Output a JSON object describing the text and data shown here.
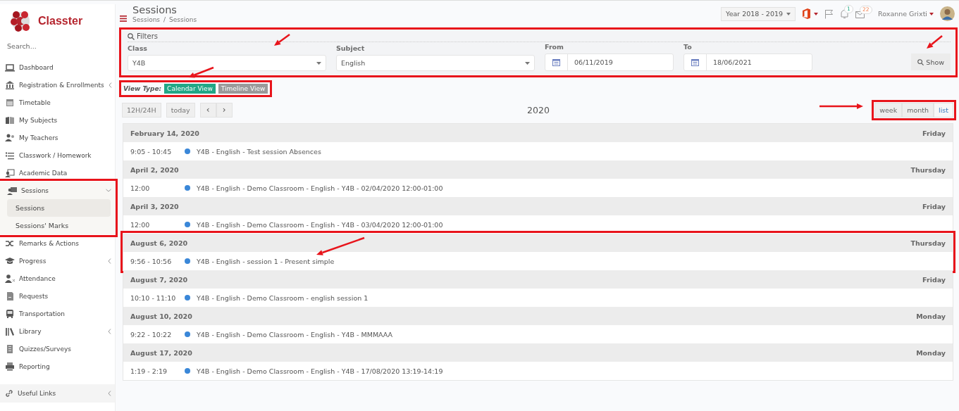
{
  "brand": {
    "name": "Classter"
  },
  "sidebar": {
    "search_placeholder": "Search...",
    "items": [
      {
        "label": "Dashboard",
        "expandable": false
      },
      {
        "label": "Registration & Enrollments",
        "expandable": true
      },
      {
        "label": "Timetable",
        "expandable": false
      },
      {
        "label": "My Subjects",
        "expandable": false
      },
      {
        "label": "My Teachers",
        "expandable": false
      },
      {
        "label": "Classwork / Homework",
        "expandable": false
      },
      {
        "label": "Academic Data",
        "expandable": false
      },
      {
        "label": "Sessions",
        "expandable": true,
        "expanded": true,
        "highlighted": true,
        "children": [
          {
            "label": "Sessions",
            "selected": true
          },
          {
            "label": "Sessions' Marks",
            "selected": false
          }
        ]
      },
      {
        "label": "Remarks & Actions",
        "expandable": false
      },
      {
        "label": "Progress",
        "expandable": true
      },
      {
        "label": "Attendance",
        "expandable": false
      },
      {
        "label": "Requests",
        "expandable": false
      },
      {
        "label": "Transportation",
        "expandable": false
      },
      {
        "label": "Library",
        "expandable": true
      },
      {
        "label": "Quizzes/Surveys",
        "expandable": false
      },
      {
        "label": "Reporting",
        "expandable": false
      }
    ],
    "footer": {
      "label": "Useful Links",
      "expandable": true
    }
  },
  "header": {
    "title": "Sessions",
    "breadcrumb": [
      "Sessions",
      "Sessions"
    ],
    "breadcrumb_separator": "/",
    "year": "Year 2018 - 2019",
    "notifications": "1",
    "messages": "22",
    "user": "Roxanne Grixti"
  },
  "filters": {
    "title": "Filters",
    "highlighted": true,
    "pointer": true,
    "fields": [
      {
        "kind": "select",
        "label": "Class",
        "value": "Y4B"
      },
      {
        "kind": "select",
        "label": "Subject",
        "value": "English"
      },
      {
        "kind": "date",
        "label": "From",
        "value": "06/11/2019"
      },
      {
        "kind": "date",
        "label": "To",
        "value": "18/06/2021"
      }
    ],
    "show_button": {
      "label": "Show",
      "pointer": true
    }
  },
  "view_type": {
    "label": "View Type:",
    "highlighted": true,
    "pointer": true,
    "options": [
      {
        "label": "Calendar View",
        "selected": true
      },
      {
        "label": "Timeline View",
        "selected": false
      }
    ]
  },
  "calendar": {
    "buttons": [
      "12H/24H",
      "today"
    ],
    "prev": "‹",
    "next": "›",
    "title": "2020",
    "views": {
      "highlighted": true,
      "pointer": true,
      "options": [
        {
          "label": "week",
          "selected": false
        },
        {
          "label": "month",
          "selected": false
        },
        {
          "label": "list",
          "selected": true
        }
      ]
    },
    "days": [
      {
        "date": "February 14, 2020",
        "weekday": "Friday",
        "highlighted": false,
        "pointer": false,
        "events": [
          {
            "time": "9:05 - 10:45",
            "title": "Y4B - English - Test session Absences"
          }
        ]
      },
      {
        "date": "April 2, 2020",
        "weekday": "Thursday",
        "highlighted": false,
        "pointer": false,
        "events": [
          {
            "time": "12:00",
            "title": "Y4B - English - Demo Classroom - English - Y4B - 02/04/2020 12:00-01:00"
          }
        ]
      },
      {
        "date": "April 3, 2020",
        "weekday": "Friday",
        "highlighted": false,
        "pointer": false,
        "events": [
          {
            "time": "12:00",
            "title": "Y4B - English - Demo Classroom - English - Y4B - 03/04/2020 12:00-01:00"
          }
        ]
      },
      {
        "date": "August 6, 2020",
        "weekday": "Thursday",
        "highlighted": true,
        "pointer": true,
        "events": [
          {
            "time": "9:56 - 10:56",
            "title": "Y4B - English - session 1 - Present simple"
          }
        ]
      },
      {
        "date": "August 7, 2020",
        "weekday": "Friday",
        "highlighted": false,
        "pointer": false,
        "events": [
          {
            "time": "10:10 - 11:10",
            "title": "Y4B - English - Demo Classroom - english session 1"
          }
        ]
      },
      {
        "date": "August 10, 2020",
        "weekday": "Monday",
        "highlighted": false,
        "pointer": false,
        "events": [
          {
            "time": "9:22 - 10:22",
            "title": "Y4B - English - Demo Classroom - English - Y4B - MMMAAA"
          }
        ]
      },
      {
        "date": "August 17, 2020",
        "weekday": "Monday",
        "highlighted": false,
        "pointer": false,
        "events": [
          {
            "time": "1:19 - 2:19",
            "title": "Y4B - English - Demo Classroom - English - Y4B - 17/08/2020 13:19-14:19"
          }
        ]
      }
    ]
  }
}
